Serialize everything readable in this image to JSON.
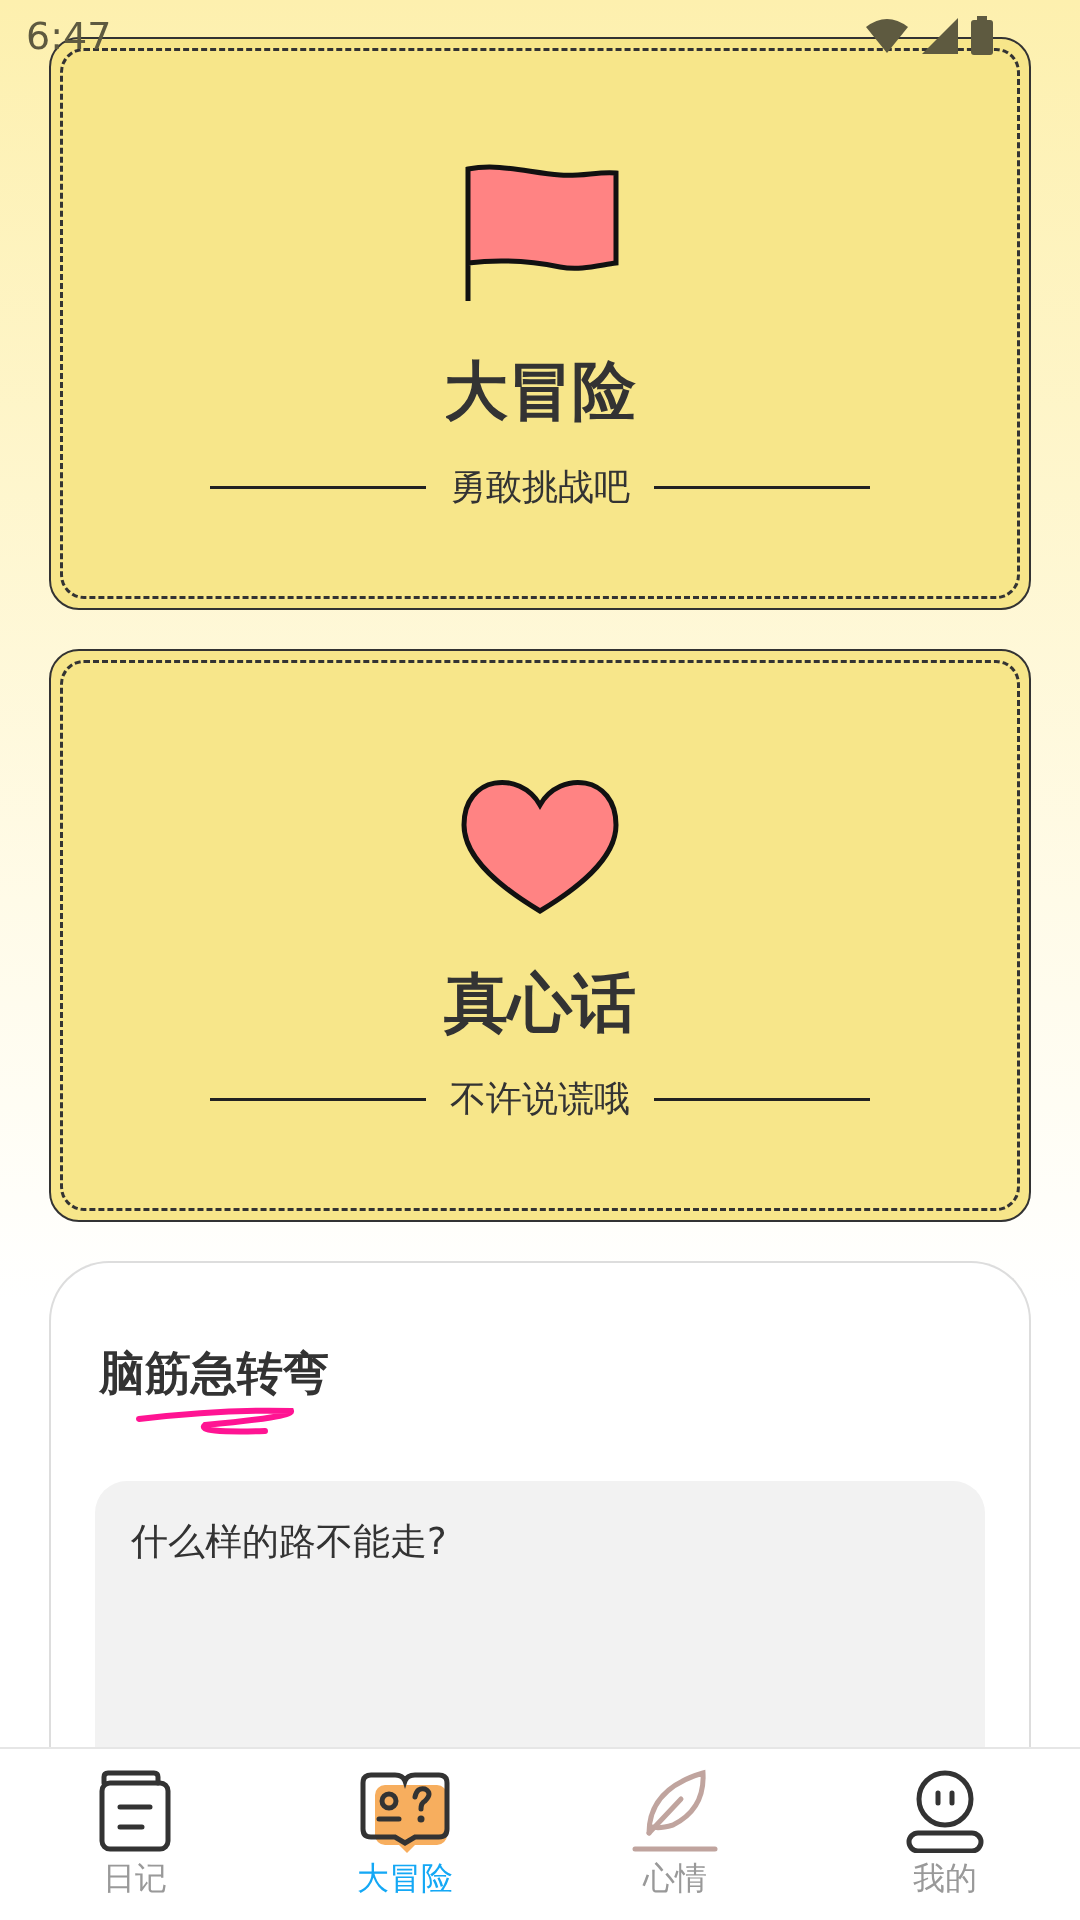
{
  "status_bar": {
    "time": "6:47"
  },
  "cards": [
    {
      "kind": "flag",
      "title": "大冒险",
      "subtitle": "勇敢挑战吧"
    },
    {
      "kind": "heart",
      "title": "真心话",
      "subtitle": "不许说谎哦"
    }
  ],
  "riddle": {
    "title": "脑筋急转弯",
    "question": "什么样的路不能走?"
  },
  "tab_bar": [
    {
      "kind": "diary",
      "label": "日记",
      "selected": false
    },
    {
      "kind": "adventure",
      "label": "大冒险",
      "selected": true
    },
    {
      "kind": "mood",
      "label": "心情",
      "selected": false
    },
    {
      "kind": "me",
      "label": "我的",
      "selected": false
    }
  ]
}
